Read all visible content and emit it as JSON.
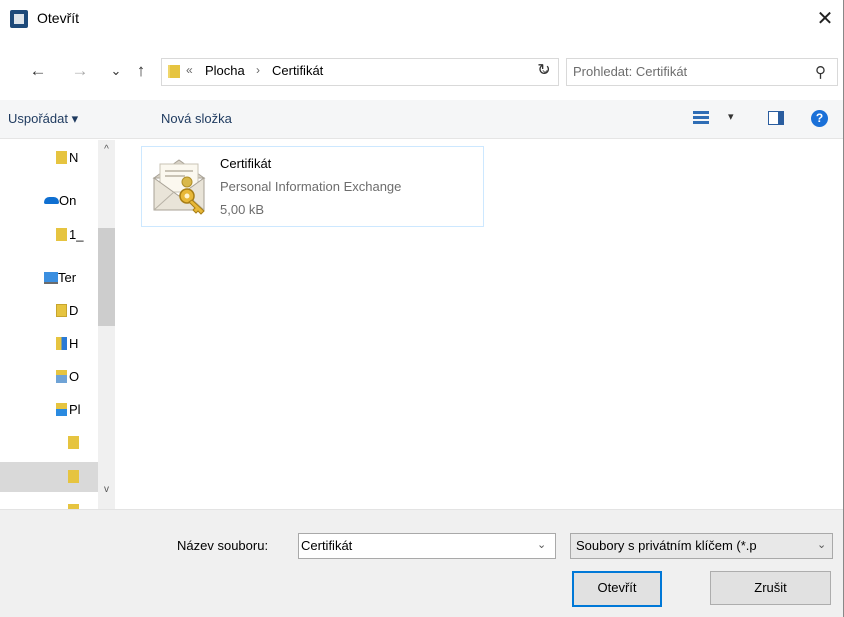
{
  "window": {
    "title": "Otevřít",
    "close_symbol": "✕"
  },
  "nav_buttons": {
    "back": "←",
    "forward": "→",
    "recent": "⌄",
    "up": "↑"
  },
  "address": {
    "overflow": "«",
    "crumbs": [
      "Plocha",
      "Certifikát"
    ],
    "separator": "›",
    "dropdown": "⌄",
    "refresh": "↻"
  },
  "search": {
    "placeholder": "Prohledat: Certifikát",
    "icon": "⚲"
  },
  "toolbar": {
    "organize_label": "Uspořádat ▾",
    "new_folder_label": "Nová složka",
    "view_dropdown": "▾",
    "help_label": "?"
  },
  "nav_pane": {
    "items": [
      {
        "label": "N",
        "icon": "folder-icon"
      },
      {
        "label": "On",
        "icon": "onedrive-icon"
      },
      {
        "label": "1_",
        "icon": "folder-icon"
      },
      {
        "label": "Ter",
        "icon": "computer-icon"
      },
      {
        "label": "D",
        "icon": "documents-icon"
      },
      {
        "label": "H",
        "icon": "music-icon"
      },
      {
        "label": "O",
        "icon": "pictures-icon"
      },
      {
        "label": "Pl",
        "icon": "desktop-folder-icon"
      },
      {
        "label": "",
        "icon": "folder-icon"
      },
      {
        "label": "",
        "icon": "folder-icon"
      },
      {
        "label": "",
        "icon": "folder-icon"
      }
    ],
    "scroll_up": "^",
    "scroll_down": "v"
  },
  "files": [
    {
      "name": "Certifikát",
      "type": "Personal Information Exchange",
      "size": "5,00 kB",
      "icon": "certificate-envelope-key-icon"
    }
  ],
  "bottom": {
    "filename_label": "Název souboru:",
    "filename_value": "Certifikát",
    "filename_dropdown": "⌄",
    "filetype_value": "Soubory s privátním klíčem (*.p",
    "filetype_dropdown": "⌄",
    "open_button": "Otevřít",
    "cancel_button": "Zrušit"
  },
  "colors": {
    "accent": "#0078d7",
    "folder": "#e6c440",
    "help": "#1a70d8"
  }
}
